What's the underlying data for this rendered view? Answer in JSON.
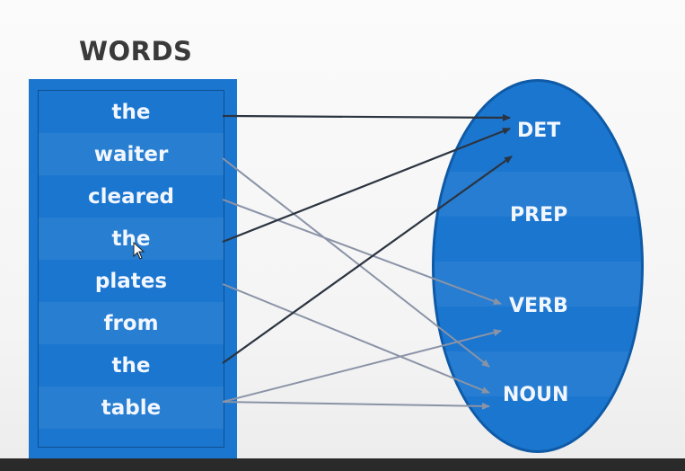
{
  "title": "WORDS",
  "words": [
    "the",
    "waiter",
    "cleared",
    "the",
    "plates",
    "from",
    "the",
    "table"
  ],
  "tags": [
    "DET",
    "PREP",
    "VERB",
    "NOUN"
  ],
  "links": [
    {
      "from": 0,
      "to": "DET",
      "color": "#2b3440"
    },
    {
      "from": 1,
      "to": "NOUN",
      "color": "#8a93a6"
    },
    {
      "from": 2,
      "to": "VERB",
      "color": "#8a93a6"
    },
    {
      "from": 3,
      "to": "DET",
      "color": "#2b3440"
    },
    {
      "from": 4,
      "to": "NOUN",
      "color": "#8a93a6"
    },
    {
      "from": 6,
      "to": "DET",
      "color": "#2b3440"
    },
    {
      "from": 7,
      "to": "VERB",
      "color": "#8a93a6"
    },
    {
      "from": 7,
      "to": "NOUN",
      "color": "#8a93a6"
    }
  ],
  "colors": {
    "box": "#1b76cf",
    "dark_arrow": "#2b3440",
    "light_arrow": "#8a93a6"
  }
}
